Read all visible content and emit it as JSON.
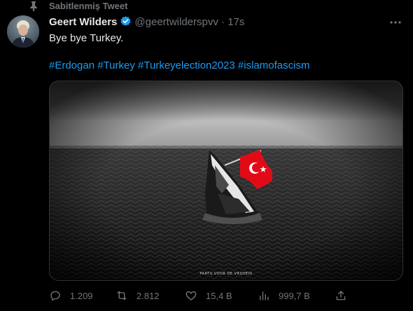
{
  "pinned": {
    "label": "Sabitlenmiş Tweet",
    "icon": "pin-icon"
  },
  "author": {
    "name": "Geert Wilders",
    "handle": "@geertwilderspvv",
    "separator": "·",
    "time": "17s",
    "verified_icon": "verified-badge-icon",
    "verified_color": "#1d9bf0"
  },
  "tweet": {
    "text": "Bye bye Turkey.",
    "hashtags": [
      "#Erdogan",
      "#Turkey",
      "#Turkeyelection2023",
      "#islamofascism"
    ],
    "hashtag_color": "#1d9bf0"
  },
  "media": {
    "watermark": "PARTIJ VOOR DE VRIJHEID",
    "flag_color": "#e30a17"
  },
  "actions": {
    "reply_count": "1.209",
    "retweet_count": "2.812",
    "like_count": "15,4 B",
    "view_count": "999,7 B"
  },
  "colors": {
    "background": "#000000",
    "text_primary": "#e7e9ea",
    "text_secondary": "#71767b",
    "accent": "#1d9bf0"
  }
}
